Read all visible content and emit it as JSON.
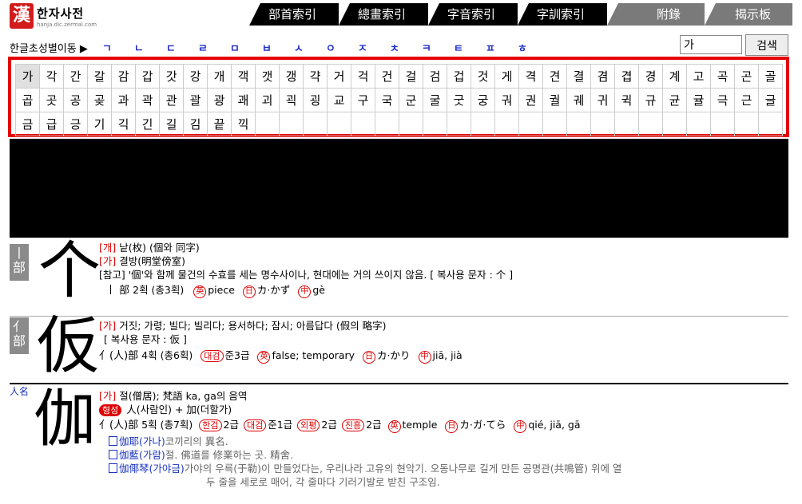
{
  "header": {
    "logo_mark": "漢",
    "logo_title": "한자사전",
    "logo_url": "hanja.dic.zermal.com",
    "tabs": [
      "部首索引",
      "總畫索引",
      "字音索引",
      "字訓索引",
      "附錄",
      "揭示板"
    ]
  },
  "chosung": {
    "label": "한글초성별이동 ▶",
    "letters": [
      "ㄱ",
      "ㄴ",
      "ㄷ",
      "ㄹ",
      "ㅁ",
      "ㅂ",
      "ㅅ",
      "ㅇ",
      "ㅈ",
      "ㅊ",
      "ㅋ",
      "ㅌ",
      "ㅍ",
      "ㅎ"
    ]
  },
  "search": {
    "value": "가",
    "button": "검색"
  },
  "syllables": [
    [
      "가",
      "각",
      "간",
      "갈",
      "감",
      "갑",
      "갓",
      "강",
      "개",
      "객",
      "갯",
      "갱",
      "갹",
      "거",
      "걱",
      "건",
      "걸",
      "검",
      "겁",
      "것",
      "게",
      "격",
      "견",
      "결",
      "겸",
      "겹",
      "경",
      "계",
      "고",
      "곡",
      "곤",
      "골"
    ],
    [
      "곱",
      "곳",
      "공",
      "곶",
      "과",
      "곽",
      "관",
      "괄",
      "광",
      "괘",
      "괴",
      "괵",
      "굉",
      "교",
      "구",
      "국",
      "군",
      "굴",
      "굿",
      "궁",
      "궈",
      "권",
      "궐",
      "궤",
      "귀",
      "귁",
      "규",
      "균",
      "귤",
      "극",
      "근",
      "글"
    ],
    [
      "금",
      "급",
      "긍",
      "기",
      "긱",
      "긴",
      "길",
      "김",
      "끝",
      "끽",
      "",
      "",
      "",
      "",
      "",
      "",
      "",
      "",
      "",
      "",
      "",
      "",
      "",
      "",
      "",
      "",
      "",
      "",
      "",
      "",
      "",
      ""
    ]
  ],
  "selected_syllable": "가",
  "entries": [
    {
      "radical_tag": "亻部",
      "char": "个",
      "lines": [
        {
          "tag": "[개]",
          "text": "낱(枚) (個와 同字)"
        },
        {
          "tag": "[가]",
          "text": "결방(明堂傍室)"
        },
        {
          "tag": "",
          "text": "[참고] '個'와 함께 물건의 수효를 세는 명수사이나, 현대에는 거의 쓰이지 않음.  [ 복사용 문자 : 个 ]"
        }
      ],
      "meta": {
        "radical": "丨 部",
        "strokes": "2획 (총3획)",
        "en": "piece",
        "ja": "カ·かず",
        "zh": "gè"
      }
    },
    {
      "radical_tag": "亻部",
      "char": "仮",
      "lines": [
        {
          "tag": "[가]",
          "text": "거짓; 가령; 빌다; 빌리다; 용서하다; 잠시; 아름답다 (假의 略字)"
        },
        {
          "tag": "",
          "text": "[ 복사용 문자 : 仮 ]"
        }
      ],
      "meta": {
        "radical": "亻(人)部",
        "strokes": "4획 (총6획)",
        "grade_label": "대검",
        "grade": "준3급",
        "en": "false; temporary",
        "ja": "カ·かり",
        "zh": "jiā, jià"
      }
    },
    {
      "radical_tag": "人名",
      "char": "伽",
      "lines": [
        {
          "tag": "[가]",
          "text": "절(僧居); 梵語 ka, ga의 음역"
        },
        {
          "tag": "형성",
          "text": "人(사람인) + 加(더할가)"
        }
      ],
      "meta": {
        "radical": "亻(人)部",
        "strokes": "5획 (총7획)",
        "g1_label": "한검",
        "g1": "2급",
        "g2_label": "대검",
        "g2": "준1급",
        "g3_label": "외평",
        "g3": "2급",
        "g4_label": "진흥",
        "g4": "2급",
        "en": "temple",
        "ja": "カ·ガ·てら",
        "zh": "qié, jiā, gā"
      },
      "words": [
        {
          "word": "伽耶(가나)",
          "desc": "코끼리의 異名."
        },
        {
          "word": "伽藍(가람)",
          "desc": "절. 佛道를 修業하는 곳. 精舍."
        },
        {
          "word": "伽倻琴(가야금)",
          "desc": "가야의 우륵(于勒)이 만들었다는, 우리나라 고유의 현악기. 오동나무로 길게 만든 공명관(共鳴管) 위에 열"
        },
        {
          "word": "",
          "desc": "두 줄을 세로로 매어, 각 줄마다 기러기발로 받친 구조임."
        }
      ]
    }
  ],
  "icons": {
    "en": "英",
    "ja": "日",
    "zh": "中"
  }
}
